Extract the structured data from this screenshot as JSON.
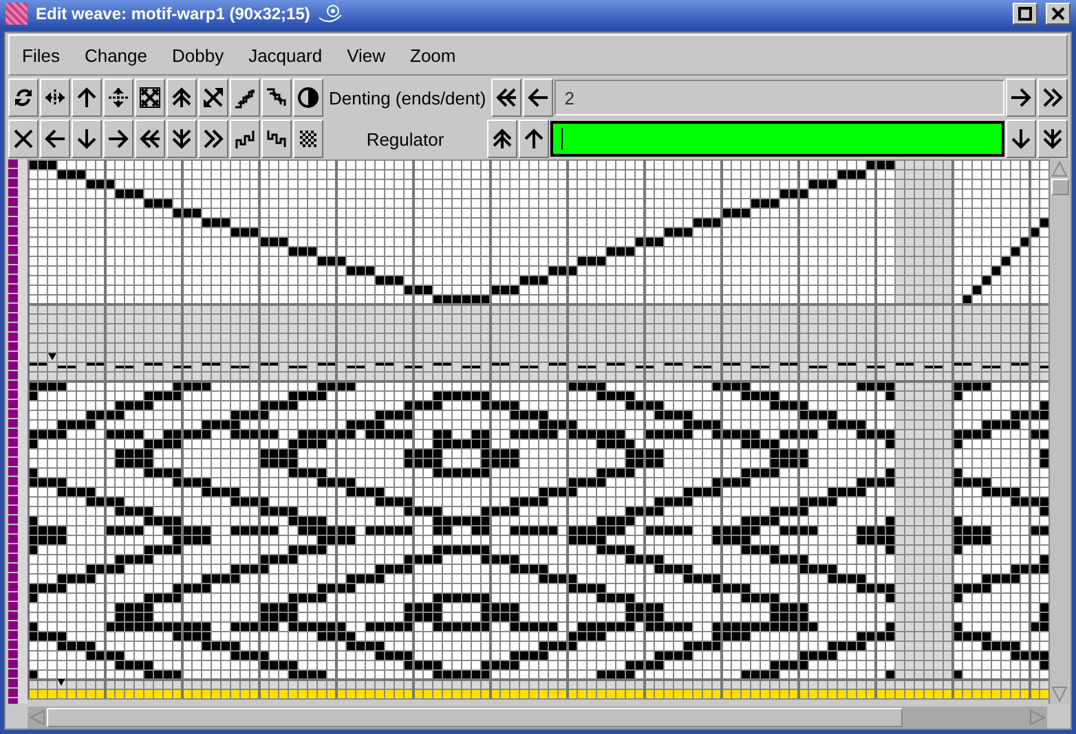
{
  "window": {
    "title": "Edit weave: motif-warp1 (90x32;15)"
  },
  "menu": [
    "Files",
    "Change",
    "Dobby",
    "Jacquard",
    "View",
    "Zoom"
  ],
  "denting": {
    "label": "Denting (ends/dent)",
    "value": "2"
  },
  "regulator": {
    "label": "Regulator",
    "focused": true
  }
}
